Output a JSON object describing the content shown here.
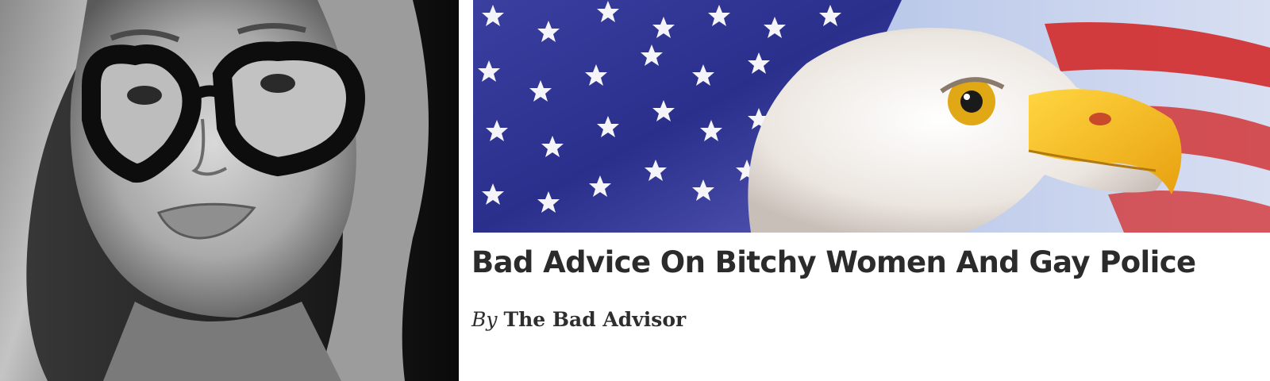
{
  "article": {
    "title": "Bad Advice On Bitchy Women And Gay Police",
    "byline_prefix": "By",
    "author": "The Bad Advisor"
  },
  "images": {
    "portrait": {
      "icon": "author-portrait-photo",
      "style": "black-and-white"
    },
    "hero": {
      "icon": "american-flag-bald-eagle-photo"
    }
  },
  "colors": {
    "headline": "#2b2b2b",
    "byline": "#2e2e2e",
    "flag_blue": "#2a2f8c",
    "flag_red": "#d12a2a",
    "beak_yellow": "#f2c21a"
  }
}
